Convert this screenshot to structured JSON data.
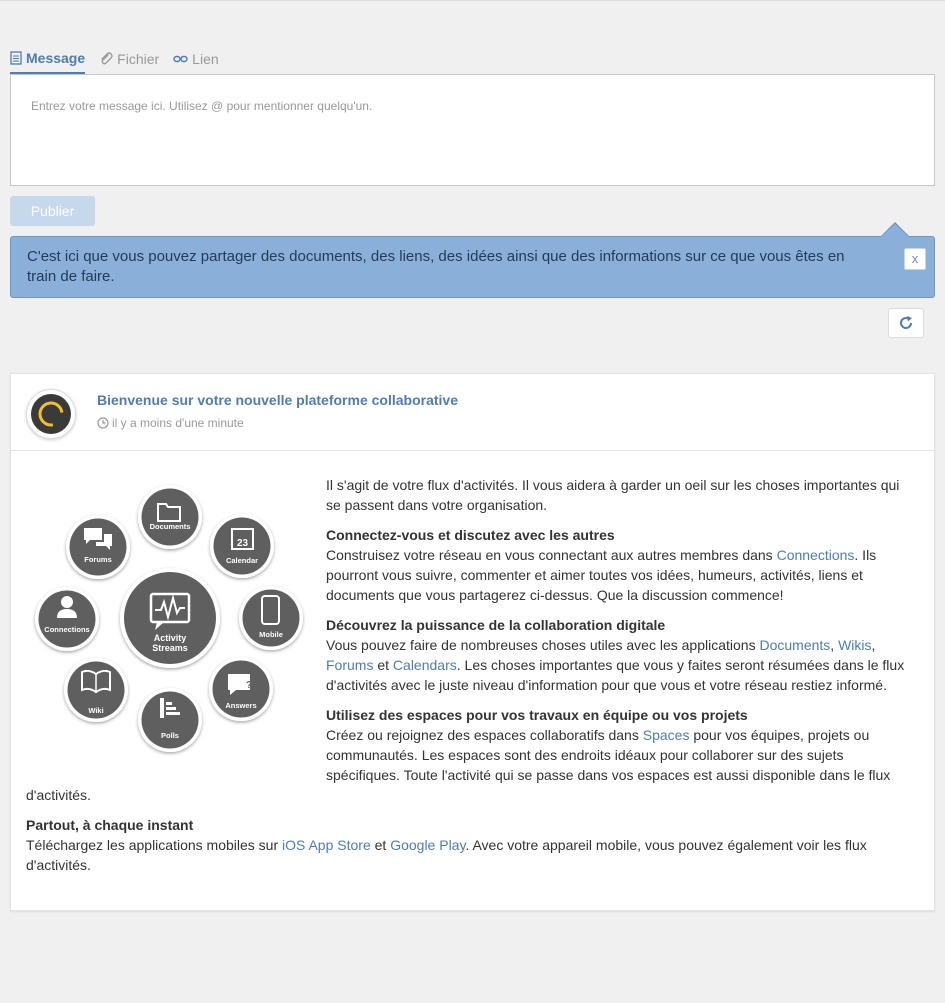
{
  "tabs": [
    {
      "label": "Message",
      "icon": "document-icon",
      "active": true
    },
    {
      "label": "Fichier",
      "icon": "paperclip-icon",
      "active": false
    },
    {
      "label": "Lien",
      "icon": "link-icon",
      "active": false
    }
  ],
  "composer": {
    "placeholder": "Entrez votre message ici. Utilisez @ pour mentionner quelqu'un."
  },
  "publish_label": "Publier",
  "tip": {
    "text": "C'est ici que vous pouvez partager des documents, des liens, des idées ainsi que des informations sur ce que vous êtes en train de faire.",
    "close": "x"
  },
  "activity": {
    "title": "Bienvenue sur votre nouvelle plateforme collaborative",
    "time": "il y a moins d'une minute",
    "diagram": {
      "center": [
        "Activity",
        "Streams"
      ],
      "items": [
        "Documents",
        "Calendar",
        "Mobile",
        "Answers",
        "Polls",
        "Wiki",
        "Connections",
        "Forums"
      ],
      "day": "23"
    },
    "intro": "Il s'agit de votre flux d'activités. Il vous aidera à garder un oeil sur les choses importantes qui se passent dans votre organisation.",
    "s1": {
      "heading": "Connectez-vous et discutez avec les autres",
      "t1": "Construisez votre réseau en vous connectant aux autres membres dans ",
      "l1": "Connections",
      "t2": ". Ils pourront vous suivre, commenter et aimer toutes vos idées, humeurs, activités, liens et documents que vous partagerez ci-dessus. Que la discussion commence!"
    },
    "s2": {
      "heading": "Découvrez la puissance de la collaboration digitale",
      "t1": "Vous pouvez faire de nombreuses choses utiles avec les applications ",
      "l1": "Documents",
      "t2": ", ",
      "l2": "Wikis",
      "t3": ", ",
      "l3": "Forums",
      "t4": " et ",
      "l4": "Calendars",
      "t5": ". Les choses importantes que vous y faites seront résumées dans le flux d'activités avec le juste niveau d'information pour que vous et votre réseau restiez informé."
    },
    "s3": {
      "heading": "Utilisez des espaces pour vos travaux en équipe ou vos projets",
      "t1": "Créez ou rejoignez des espaces collaboratifs dans ",
      "l1": "Spaces",
      "t2": " pour vos équipes, projets ou communautés. Les espaces sont des endroits idéaux pour collaborer sur des sujets spécifiques. Toute l'activité qui se passe dans vos espaces est aussi disponible dans le flux d'activités."
    },
    "s4": {
      "heading": "Partout, à chaque instant",
      "t1": "Téléchargez les applications mobiles sur ",
      "l1": "iOS App Store",
      "t2": " et ",
      "l2": "Google Play",
      "t3": ". Avec votre appareil mobile, vous pouvez également voir les flux d'activités."
    }
  },
  "colors": {
    "accent": "#4c7db5",
    "tip_bg": "#8ab0da",
    "publish_disabled": "#c6d8ec",
    "bubble": "#5f5f5f",
    "loader_ring": "#f2c029"
  }
}
